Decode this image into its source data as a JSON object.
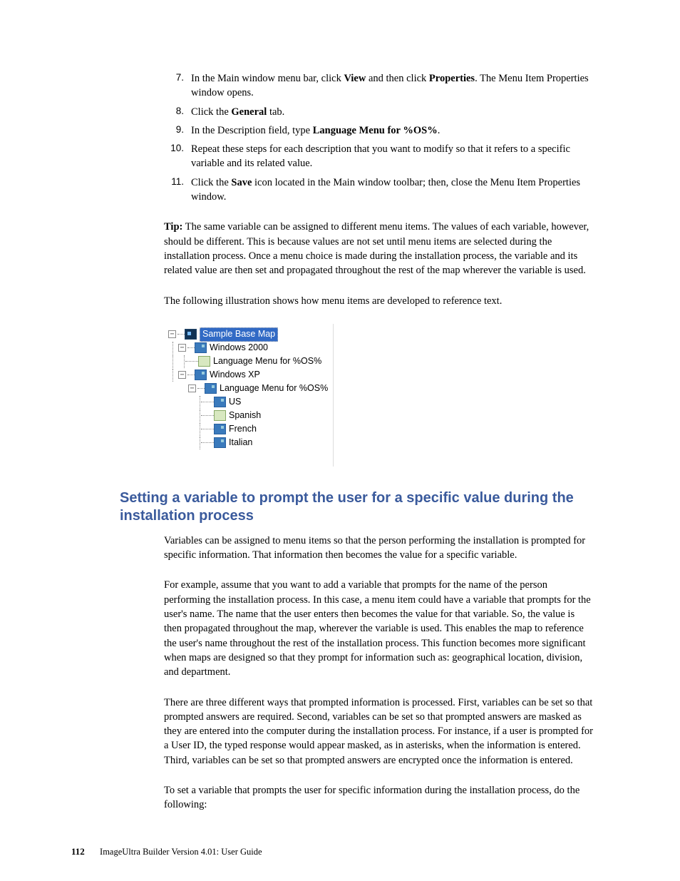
{
  "steps": [
    {
      "num": "7.",
      "pre": "In the Main window menu bar, click ",
      "b1": "View",
      "mid": " and then click ",
      "b2": "Properties",
      "post": ". The Menu Item Properties window opens."
    },
    {
      "num": "8.",
      "pre": "Click the ",
      "b1": "General",
      "mid": "",
      "b2": "",
      "post": " tab."
    },
    {
      "num": "9.",
      "pre": "In the Description field, type ",
      "b1": "Language Menu for %OS%",
      "mid": "",
      "b2": "",
      "post": "."
    },
    {
      "num": "10.",
      "pre": "Repeat these steps for each description that you want to modify so that it refers to a specific variable and its related value.",
      "b1": "",
      "mid": "",
      "b2": "",
      "post": ""
    },
    {
      "num": "11.",
      "pre": "Click the ",
      "b1": "Save",
      "mid": " icon located in the Main window toolbar; then, close the Menu Item Properties window.",
      "b2": "",
      "post": ""
    }
  ],
  "tip_label": "Tip:",
  "tip_body": " The same variable can be assigned to different menu items. The values of each variable, however, should be different. This is because values are not set until menu items are selected during the installation process. Once a menu choice is made during the installation process, the variable and its related value are then set and propagated throughout the rest of the map wherever the variable is used.",
  "illus_intro": "The following illustration shows how menu items are developed to reference text.",
  "tree": {
    "root": "Sample Base Map",
    "w2000": "Windows 2000",
    "w2000_lang": "Language Menu for %OS%",
    "wxp": "Windows XP",
    "wxp_lang": "Language Menu for %OS%",
    "us": "US",
    "sp": "Spanish",
    "fr": "French",
    "it": "Italian"
  },
  "heading": "Setting a variable to prompt the user for a specific value during the installation process",
  "p1": "Variables can be assigned to menu items so that the person performing the installation is prompted for specific information. That information then becomes the value for a specific variable.",
  "p2": "For example, assume that you want to add a variable that prompts for the name of the person performing the installation process. In this case, a menu item could have a variable that prompts for the user's name. The name that the user enters then becomes the value for that variable. So, the value is then propagated throughout the map, wherever the variable is used. This enables the map to reference the user's name throughout the rest of the installation process. This function becomes more significant when maps are designed so that they prompt for information such as: geographical location, division, and department.",
  "p3": "There are three different ways that prompted information is processed. First, variables can be set so that prompted answers are required. Second, variables can be set so that prompted answers are masked as they are entered into the computer during the installation process. For instance, if a user is prompted for a User ID, the typed response would appear masked, as in asterisks, when the information is entered. Third, variables can be set so that prompted answers are encrypted once the information is entered.",
  "p4": "To set a variable that prompts the user for specific information during the installation process, do the following:",
  "footer": {
    "page": "112",
    "text": "ImageUltra Builder Version 4.01:  User Guide"
  }
}
